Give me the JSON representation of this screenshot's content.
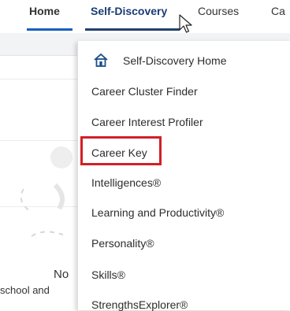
{
  "nav": {
    "tabs": [
      {
        "label": "Home"
      },
      {
        "label": "Self-Discovery"
      },
      {
        "label": "Courses"
      },
      {
        "label": "Ca"
      }
    ]
  },
  "menu": {
    "items": [
      {
        "label": "Self-Discovery Home",
        "icon": "home-icon"
      },
      {
        "label": "Career Cluster Finder"
      },
      {
        "label": "Career Interest Profiler"
      },
      {
        "label": "Career Key"
      },
      {
        "label": "Intelligences®"
      },
      {
        "label": "Learning and Productivity®"
      },
      {
        "label": "Personality®"
      },
      {
        "label": "Skills®"
      },
      {
        "label": "StrengthsExplorer®"
      }
    ],
    "highlight_color": "#d21f27"
  },
  "background": {
    "text_no": "No",
    "text_school": "school and"
  }
}
